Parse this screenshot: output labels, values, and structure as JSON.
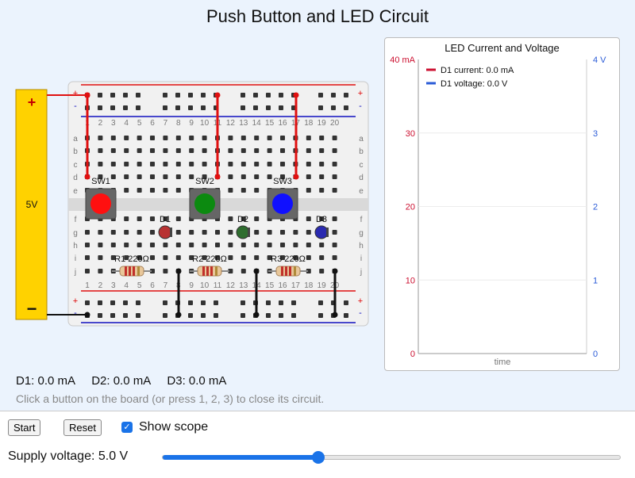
{
  "title": "Push Button and LED Circuit",
  "battery": {
    "plus": "+",
    "minus": "−",
    "voltage_label": "5V"
  },
  "breadboard": {
    "column_numbers": [
      "1",
      "2",
      "3",
      "4",
      "5",
      "6",
      "7",
      "8",
      "9",
      "10",
      "11",
      "12",
      "13",
      "14",
      "15",
      "16",
      "17",
      "18",
      "19",
      "20"
    ],
    "top_row_letters": [
      "b",
      "c",
      "d",
      "e"
    ],
    "bottom_row_letters": [
      "f",
      "g",
      "h",
      "i",
      "j"
    ],
    "top_labels": [
      "b",
      "c",
      "d",
      "e"
    ],
    "rail_plus": "+",
    "rail_minus": "-",
    "switches": [
      {
        "label": "SW1",
        "color": "#ff1010"
      },
      {
        "label": "SW2",
        "color": "#0c8a10"
      },
      {
        "label": "SW3",
        "color": "#1010ff"
      }
    ],
    "leds": [
      {
        "label": "D1",
        "color": "#b83232"
      },
      {
        "label": "D2",
        "color": "#2f6e2f"
      },
      {
        "label": "D3",
        "color": "#2a2ab0"
      }
    ],
    "resistors": [
      {
        "label": "R1 220Ω"
      },
      {
        "label": "R2 220Ω"
      },
      {
        "label": "R3 220Ω"
      }
    ]
  },
  "scope": {
    "title": "LED Current and Voltage",
    "legend": [
      {
        "label": "D1 current: 0.0 mA",
        "color": "#cc1030"
      },
      {
        "label": "D1 voltage: 0.0 V",
        "color": "#2a5bd7"
      }
    ],
    "left_ticks": [
      "40 mA",
      "30",
      "20",
      "10",
      "0"
    ],
    "right_ticks": [
      "4 V",
      "3",
      "2",
      "1",
      "0"
    ],
    "xlabel": "time"
  },
  "readouts": {
    "d1": "D1: 0.0 mA",
    "d2": "D2: 0.0 mA",
    "d3": "D3: 0.0 mA",
    "hint": "Click a button on the board (or press 1, 2, 3) to close its circuit."
  },
  "controls": {
    "start": "Start",
    "reset": "Reset",
    "show_scope": "Show scope",
    "show_scope_checked": true,
    "supply_label": "Supply voltage: 5.0 V",
    "supply_fraction": 0.34
  },
  "colors": {
    "current": "#cc1030",
    "voltage": "#2a5bd7",
    "accent": "#1a73e8",
    "battery": "#ffd200"
  }
}
